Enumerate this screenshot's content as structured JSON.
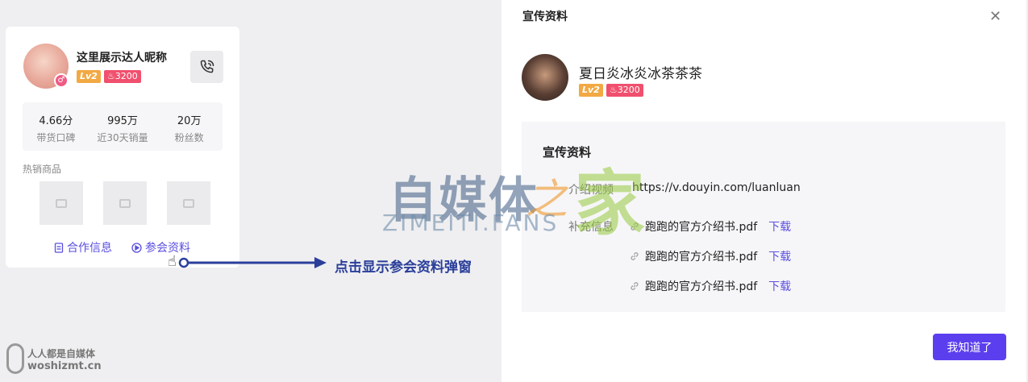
{
  "card": {
    "nickname": "这里展示达人昵称",
    "level": "Lv2",
    "fans_badge": "♨3200",
    "stats": [
      {
        "value": "4.66分",
        "label": "带货口碑"
      },
      {
        "value": "995万",
        "label": "近30天销量"
      },
      {
        "value": "20万",
        "label": "粉丝数"
      }
    ],
    "hot_title": "热销商品",
    "links": {
      "coop": "合作信息",
      "material": "参会资料"
    }
  },
  "annotation": {
    "arrow_label": "点击显示参会资料弹窗"
  },
  "watermark": {
    "main": "自媒体",
    "zhi": "之",
    "jia": "家",
    "sub": "ZIMEITI.FANS",
    "bl1": "人人都是自媒体",
    "bl2": "woshizmt.cn"
  },
  "panel": {
    "title": "宣传资料",
    "close_glyph": "✕",
    "nickname": "夏日炎冰炎冰茶茶茶",
    "level": "Lv2",
    "fans_badge": "♨3200",
    "info_title": "宣传资料",
    "video_label": "介绍视频",
    "video_url": "https://v.douyin.com/luanluan",
    "extra_label": "补充信息",
    "files": [
      {
        "name": "跑跑的官方介绍书.pdf",
        "action": "下载"
      },
      {
        "name": "跑跑的官方介绍书.pdf",
        "action": "下载"
      },
      {
        "name": "跑跑的官方介绍书.pdf",
        "action": "下载"
      }
    ],
    "ok_button": "我知道了"
  },
  "colors": {
    "accent": "#5b3fef",
    "link": "#5b4fe0",
    "annotation": "#2b3f9a",
    "fans": "#f0506e",
    "level": "#f2a944"
  }
}
